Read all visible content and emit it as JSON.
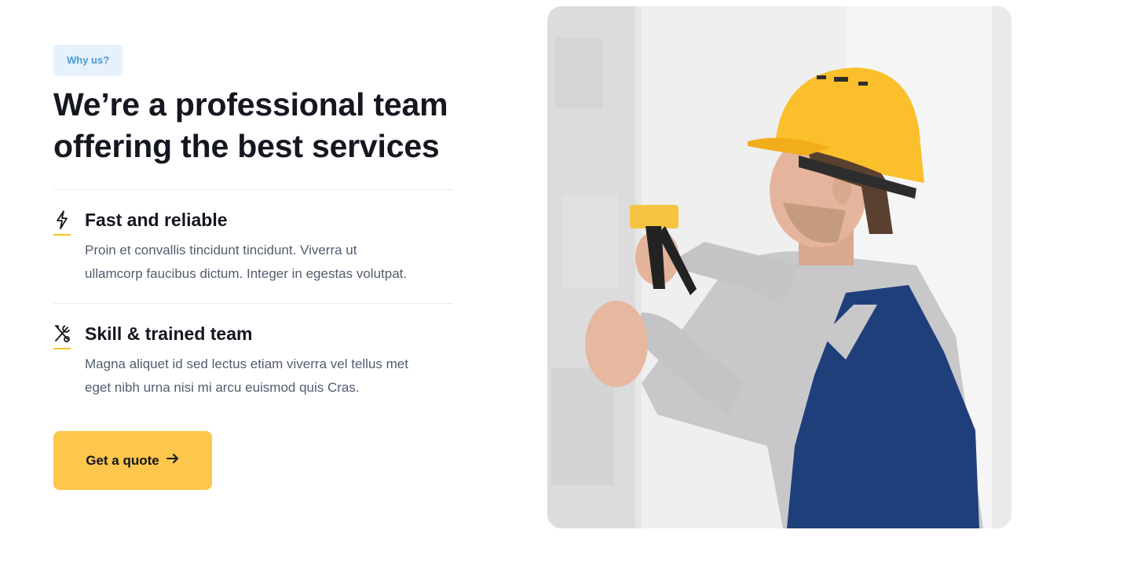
{
  "section": {
    "eyebrow": "Why us?",
    "heading_line1": "We’re a professional team",
    "heading_line2": "offering the best services"
  },
  "features": [
    {
      "icon": "lightning-icon",
      "title": "Fast and reliable",
      "text_line1": "Proin et convallis tincidunt tincidunt. Viverra ut",
      "text_line2": "ullamcorp faucibus dictum. Integer in egestas volutpat."
    },
    {
      "icon": "tools-icon",
      "title": "Skill & trained team",
      "text_line1": "Magna aliquet id sed lectus etiam viverra vel tellus met",
      "text_line2": "eget nibh urna nisi mi arcu euismod quis Cras."
    }
  ],
  "cta": {
    "label": "Get a quote",
    "icon": "arrow-right-icon"
  },
  "image": {
    "subject": "worker-with-hard-hat-and-staple-gun"
  },
  "colors": {
    "accent": "#fdc64d",
    "eyebrow_bg": "#e6f1fb",
    "eyebrow_text": "#4a9ad8",
    "heading": "#14171f",
    "body_text": "#535c6e",
    "divider": "#e7e9ee"
  }
}
